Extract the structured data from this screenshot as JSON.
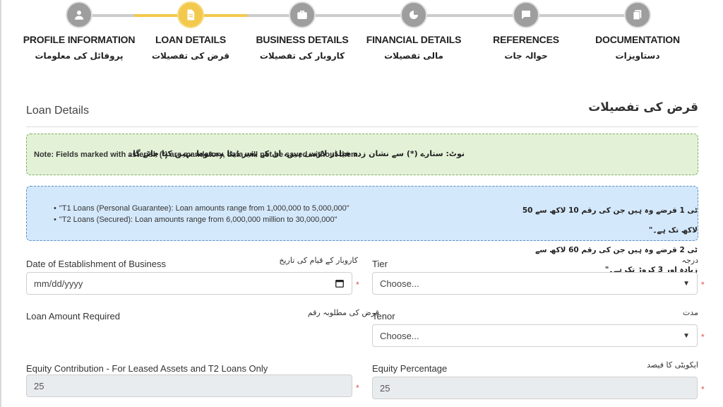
{
  "steps": [
    {
      "en": "PROFILE INFORMATION",
      "ur": "پروفائل کی معلومات",
      "icon": "user-icon",
      "active": false
    },
    {
      "en": "LOAN DETAILS",
      "ur": "قرض کی تفصیلات",
      "icon": "document-icon",
      "active": true
    },
    {
      "en": "BUSINESS DETAILS",
      "ur": "کاروبار کی تفصیلات",
      "icon": "briefcase-icon",
      "active": false
    },
    {
      "en": "FINANCIAL DETAILS",
      "ur": "مالی تفصیلات",
      "icon": "pie-chart-icon",
      "active": false
    },
    {
      "en": "REFERENCES",
      "ur": "حوالہ جات",
      "icon": "chat-icon",
      "active": false
    },
    {
      "en": "DOCUMENTATION",
      "ur": "دستاویزات",
      "icon": "files-icon",
      "active": false
    }
  ],
  "section": {
    "en": "Loan Details",
    "ur": "قرض کی تفصیلات"
  },
  "note_mandatory": {
    "en": "Note: Fields marked with asterisk (*) are mandatory, data will not be saved without them.",
    "ur": "نوٹ: ستارے (*) سے نشان زدہ فیلڈز لازمی ہیں، ان کے بغیر ڈیٹا محفوظ نہیں کیا جائے گا۔"
  },
  "note_tiers": {
    "en": [
      "\"T1 Loans (Personal Guarantee): Loan amounts range from 1,000,000 to 5,000,000\"",
      "\"T2 Loans (Secured): Loan amounts range from 6,000,000 million to 30,000,000\""
    ],
    "ur": [
      "ٹی 1 قرضے وہ ہیں جن کی رقم 10 لاکھ سے 50 لاکھ تک ہے۔\"",
      "ٹی 2 قرضے وہ ہیں جن کی رقم 60 لاکھ سے زیادہ اور 3 کروڑ تک ہے۔\""
    ]
  },
  "fields": {
    "date_est": {
      "en": "Date of Establishment of Business",
      "ur": "کاروبار کے قیام کی تاریخ",
      "placeholder": "mm/dd/yyyy"
    },
    "tier": {
      "en": "Tier",
      "ur": "درجہ",
      "value": "Choose..."
    },
    "loan_amount": {
      "en": "Loan Amount Required",
      "ur": "قرض کی مطلوبہ رقم"
    },
    "tenor": {
      "en": "Tenor",
      "ur": "مدت",
      "value": "Choose..."
    },
    "equity_contribution": {
      "en": "Equity Contribution - For Leased Assets and T2 Loans Only",
      "value": "25"
    },
    "equity_percentage": {
      "en": "Equity Percentage",
      "ur": "ایکویٹی کا فیصد",
      "value": "25"
    }
  },
  "required_mark": "*",
  "colors": {
    "active_step": "#f2c94c",
    "inactive_step": "#9e9e9e",
    "green_note": "#e3f2d7",
    "blue_note": "#d4e8fb",
    "required": "#d9534f"
  }
}
